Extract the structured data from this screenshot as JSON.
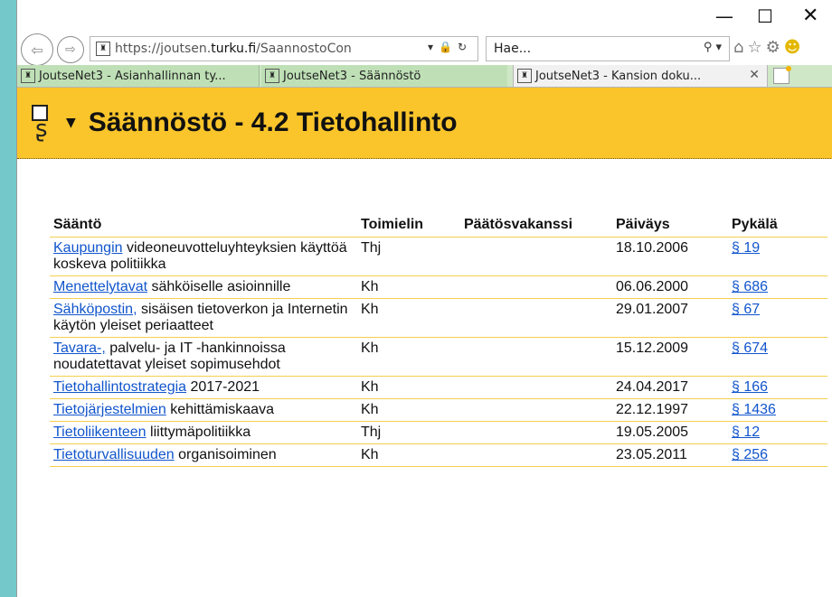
{
  "window": {
    "minimize": "—",
    "maximize": "☐",
    "close": "✕"
  },
  "nav": {
    "url_host_prefix": "https://joutsen.",
    "url_host": "turku.fi",
    "url_path": "/SaannostoCon",
    "search_value": "Hae..."
  },
  "tabs": [
    {
      "label": "JoutseNet3 - Asianhallinnan ty..."
    },
    {
      "label": "JoutseNet3 - Säännöstö"
    },
    {
      "label": "JoutseNet3 - Kansion doku..."
    }
  ],
  "header": {
    "title": "Säännöstö - 4.2 Tietohallinto"
  },
  "table": {
    "columns": [
      "Sääntö",
      "Toimielin",
      "Päätösvakanssi",
      "Päiväys",
      "Pykälä"
    ],
    "rows": [
      {
        "link": "Kaupungin",
        "rest": " videoneuvotteluyhteyksien käyttöä koskeva politiikka",
        "organ": "Thj",
        "decision": "",
        "date": "18.10.2006",
        "section": "§ 19"
      },
      {
        "link": "Menettelytavat",
        "rest": " sähköiselle asioinnille",
        "organ": "Kh",
        "decision": "",
        "date": "06.06.2000",
        "section": "§ 686"
      },
      {
        "link": "Sähköpostin,",
        "rest": " sisäisen tietoverkon ja Internetin käytön yleiset periaatteet",
        "organ": "Kh",
        "decision": "",
        "date": "29.01.2007",
        "section": "§ 67"
      },
      {
        "link": "Tavara-,",
        "rest": " palvelu- ja IT -hankinnoissa noudatettavat yleiset sopimusehdot",
        "organ": "Kh",
        "decision": "",
        "date": "15.12.2009",
        "section": "§ 674"
      },
      {
        "link": "Tietohallintostrategia",
        "rest": " 2017-2021",
        "organ": "Kh",
        "decision": "",
        "date": "24.04.2017",
        "section": "§ 166"
      },
      {
        "link": "Tietojärjestelmien",
        "rest": " kehittämiskaava",
        "organ": "Kh",
        "decision": "",
        "date": "22.12.1997",
        "section": "§ 1436"
      },
      {
        "link": "Tietoliikenteen",
        "rest": " liittymäpolitiikka",
        "organ": "Thj",
        "decision": "",
        "date": "19.05.2005",
        "section": "§ 12"
      },
      {
        "link": "Tietoturvallisuuden",
        "rest": " organisoiminen",
        "organ": "Kh",
        "decision": "",
        "date": "23.05.2011",
        "section": "§ 256"
      }
    ]
  }
}
